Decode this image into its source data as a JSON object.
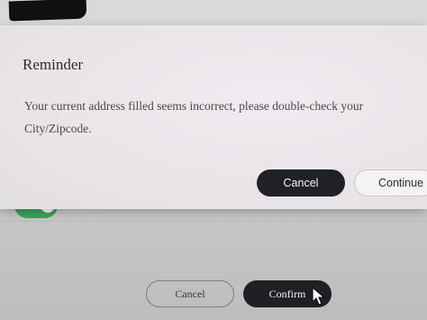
{
  "dialog": {
    "title": "Reminder",
    "message": "Your current address filled seems incorrect, please double-check your City/Zipcode.",
    "cancel_label": "Cancel",
    "continue_label": "Continue"
  },
  "footer": {
    "cancel_label": "Cancel",
    "confirm_label": "Confirm"
  },
  "colors": {
    "primary_button": "#1f2126",
    "toggle_on": "#3aa35a"
  },
  "icons": {
    "cursor": "mouse-pointer-icon"
  }
}
